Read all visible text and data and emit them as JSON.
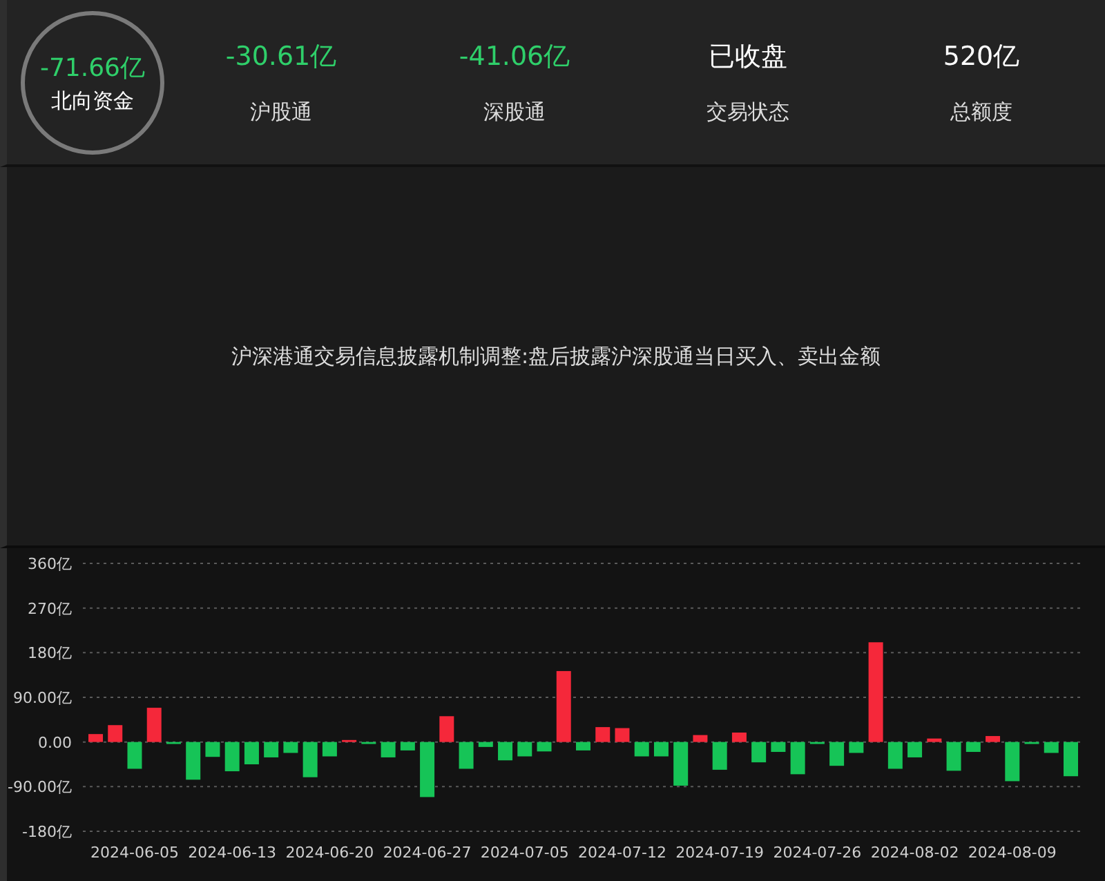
{
  "summary": {
    "total": {
      "value": "-71.66亿",
      "label": "北向资金"
    },
    "stats": [
      {
        "value": "-30.61亿",
        "label": "沪股通",
        "kind": "negative"
      },
      {
        "value": "-41.06亿",
        "label": "深股通",
        "kind": "negative"
      },
      {
        "value": "已收盘",
        "label": "交易状态",
        "kind": "neutral"
      },
      {
        "value": "520亿",
        "label": "总额度",
        "kind": "neutral"
      }
    ]
  },
  "notice": "沪深港通交易信息披露机制调整:盘后披露沪深股通当日买入、卖出金额",
  "chart": {
    "chart_data": {
      "type": "bar",
      "ylim": [
        -180,
        360
      ],
      "grid": true,
      "yticks": [
        {
          "value": 360,
          "label": "360亿"
        },
        {
          "value": 270,
          "label": "270亿"
        },
        {
          "value": 180,
          "label": "180亿"
        },
        {
          "value": 90,
          "label": "90.00亿"
        },
        {
          "value": 0,
          "label": "0.00"
        },
        {
          "value": -90,
          "label": "-90.00亿"
        },
        {
          "value": -180,
          "label": "-180亿"
        }
      ],
      "categories": [
        null,
        null,
        "2024-06-05",
        null,
        null,
        null,
        null,
        "2024-06-13",
        null,
        null,
        null,
        null,
        "2024-06-20",
        null,
        null,
        null,
        null,
        "2024-06-27",
        null,
        null,
        null,
        null,
        "2024-07-05",
        null,
        null,
        null,
        null,
        "2024-07-12",
        null,
        null,
        null,
        null,
        "2024-07-19",
        null,
        null,
        null,
        null,
        "2024-07-26",
        null,
        null,
        null,
        null,
        "2024-08-02",
        null,
        null,
        null,
        null,
        "2024-08-09",
        null,
        null,
        null
      ],
      "series": [
        {
          "values": [
            16,
            34,
            -54,
            69,
            -4,
            -76,
            -30,
            -59,
            -45,
            -31,
            -22,
            -71,
            -29,
            4,
            -4,
            -31,
            -17,
            -111,
            52,
            -54,
            -10,
            -37,
            -29,
            -19,
            143,
            -17,
            30,
            28,
            -29,
            -29,
            -88,
            14,
            -56,
            19,
            -41,
            -20,
            -65,
            -4,
            -48,
            -22,
            201,
            -54,
            -31,
            7,
            -58,
            -20,
            12,
            -79,
            -4,
            -22,
            -69
          ]
        }
      ]
    }
  }
}
